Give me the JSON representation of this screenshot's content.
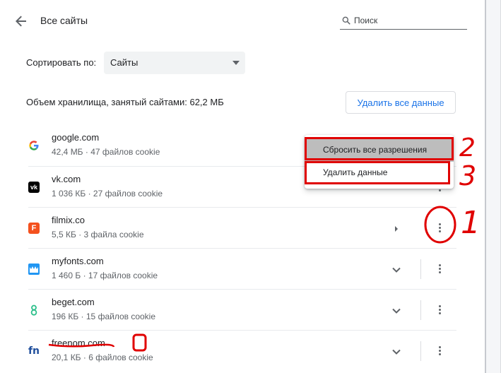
{
  "header": {
    "title": "Все сайты",
    "back_icon": "arrow-left-icon",
    "search_placeholder": "Поиск"
  },
  "sort": {
    "label": "Сортировать по:",
    "value": "Сайты"
  },
  "storage": {
    "text": "Объем хранилища, занятый сайтами: 62,2 МБ",
    "delete_all_label": "Удалить все данные"
  },
  "sites": [
    {
      "name": "google.com",
      "meta": "42,4 МБ · 47 файлов cookie"
    },
    {
      "name": "vk.com",
      "meta": "1 036 КБ · 27 файлов cookie"
    },
    {
      "name": "filmix.co",
      "meta": "5,5 КБ · 3 файла cookie"
    },
    {
      "name": "myfonts.com",
      "meta": "1 460 Б · 17 файлов cookie"
    },
    {
      "name": "beget.com",
      "meta": "196 КБ · 15 файлов cookie"
    },
    {
      "name": "freenom.com",
      "meta": "20,1 КБ · 6 файлов cookie"
    }
  ],
  "menu": {
    "reset_permissions": "Сбросить все разрешения",
    "delete_data": "Удалить данные"
  },
  "annotations": {
    "num_1": "1",
    "num_2": "2",
    "num_3": "3",
    "color": "#e00000"
  },
  "colors": {
    "accent": "#1a73e8",
    "select_bg": "#f1f3f4",
    "annotation_red": "#e00000"
  }
}
